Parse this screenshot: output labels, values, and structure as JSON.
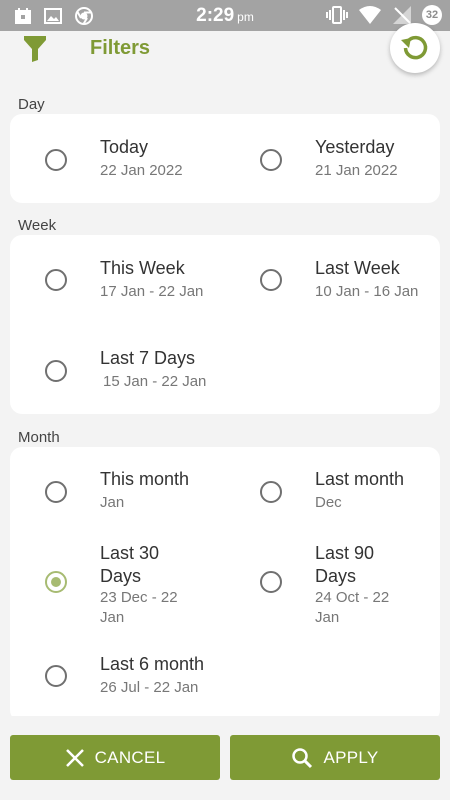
{
  "status_bar": {
    "time": "2:29",
    "ampm": "pm",
    "battery": "32"
  },
  "header": {
    "title": "Filters"
  },
  "sections": {
    "day": {
      "label": "Day",
      "options": [
        {
          "label": "Today",
          "date": "22 Jan 2022",
          "selected": false
        },
        {
          "label": "Yesterday",
          "date": "21 Jan 2022",
          "selected": false
        }
      ]
    },
    "week": {
      "label": "Week",
      "options": [
        {
          "label": "This Week",
          "date": "17 Jan - 22 Jan",
          "selected": false
        },
        {
          "label": "Last Week",
          "date": "10 Jan - 16 Jan",
          "selected": false
        },
        {
          "label": "Last 7 Days",
          "date": "15 Jan - 22 Jan",
          "selected": false
        }
      ]
    },
    "month": {
      "label": "Month",
      "options": [
        {
          "label": "This month",
          "date": "Jan",
          "selected": false
        },
        {
          "label": "Last month",
          "date": "Dec",
          "selected": false
        },
        {
          "label": "Last 30 Days",
          "date": "23 Dec - 22 Jan",
          "selected": true
        },
        {
          "label": "Last 90 Days",
          "date": "24 Oct - 22 Jan",
          "selected": false
        },
        {
          "label": "Last 6 month",
          "date": "26 Jul - 22 Jan",
          "selected": false
        }
      ]
    }
  },
  "buttons": {
    "cancel": "CANCEL",
    "apply": "APPLY"
  },
  "colors": {
    "accent": "#7f9a35",
    "selected_radio": "#a7bb72",
    "status_bar": "#a3a3a3"
  }
}
